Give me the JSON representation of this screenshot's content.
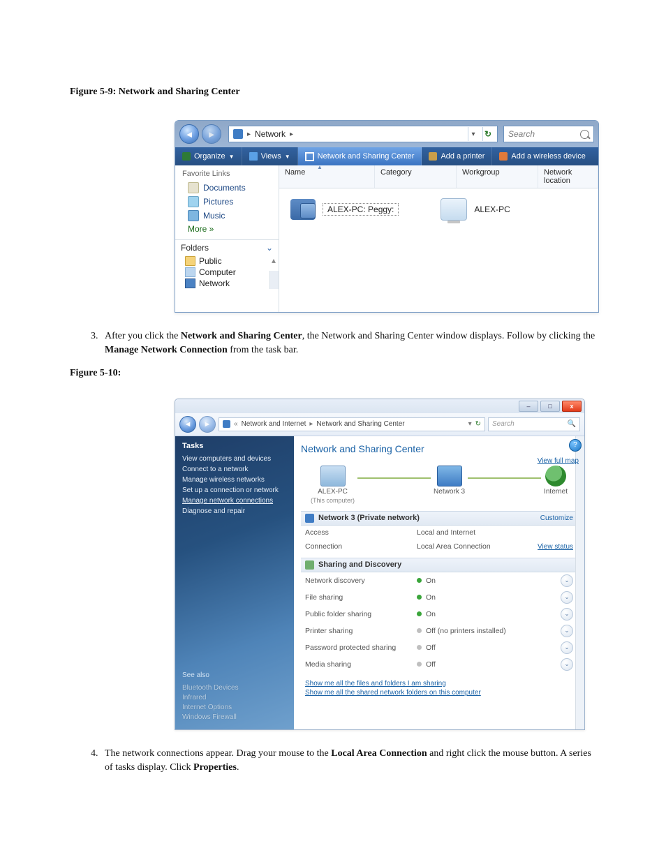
{
  "figures": {
    "f59_label": "Figure 5-9:",
    "f59_title": " Network and Sharing Center",
    "f510_label": "Figure 5-10:"
  },
  "step3": {
    "num": "3.",
    "before": "After you click the ",
    "b1": "Network and Sharing Center",
    "mid": ", the Network and Sharing Center window displays. Follow by clicking the ",
    "b2": "Manage Network Connection",
    "after": " from the task bar."
  },
  "step4": {
    "num": "4.",
    "before": "The network connections appear. Drag your mouse to the ",
    "b1": "Local Area Connection",
    "mid": " and right click the mouse button. A series of tasks display. Click ",
    "b2": "Properties",
    "after": "."
  },
  "explorer": {
    "address": {
      "root": "Network",
      "arrow": "▸"
    },
    "search_placeholder": "Search",
    "toolbar": {
      "organize": "Organize",
      "views": "Views",
      "nsc": "Network and Sharing Center",
      "add_printer": "Add a printer",
      "add_wireless": "Add a wireless device"
    },
    "nav": {
      "fav_header": "Favorite Links",
      "documents": "Documents",
      "pictures": "Pictures",
      "music": "Music",
      "more": "More  »",
      "folders_hdr": "Folders",
      "public": "Public",
      "computer": "Computer",
      "network": "Network"
    },
    "columns": {
      "name": "Name",
      "category": "Category",
      "workgroup": "Workgroup",
      "netloc": "Network location"
    },
    "items": {
      "computer_share": "ALEX-PC: Peggy:",
      "computer": "ALEX-PC"
    }
  },
  "nsc": {
    "breadcrumb": {
      "lvl1": "Network and Internet",
      "lvl2": "Network and Sharing Center",
      "back": "«"
    },
    "search_placeholder": "Search",
    "tasks_hdr": "Tasks",
    "tasks": {
      "t1": "View computers and devices",
      "t2": "Connect to a network",
      "t3": "Manage wireless networks",
      "t4": "Set up a connection or network",
      "t5": "Manage network connections",
      "t6": "Diagnose and repair"
    },
    "seealso_hdr": "See also",
    "seealso": {
      "s1": "Bluetooth Devices",
      "s2": "Infrared",
      "s3": "Internet Options",
      "s4": "Windows Firewall"
    },
    "main_title": "Network and Sharing Center",
    "view_full_map": "View full map",
    "map": {
      "pc": "ALEX-PC",
      "pc_sub": "(This computer)",
      "net": "Network 3",
      "inet": "Internet"
    },
    "panel1": {
      "title": "Network 3 (Private network)",
      "customize": "Customize"
    },
    "kv": {
      "access_k": "Access",
      "access_v": "Local and Internet",
      "conn_k": "Connection",
      "conn_v": "Local Area Connection",
      "view_status": "View status"
    },
    "panel2_title": "Sharing and Discovery",
    "sd": {
      "r1k": "Network discovery",
      "r1v": "On",
      "r2k": "File sharing",
      "r2v": "On",
      "r3k": "Public folder sharing",
      "r3v": "On",
      "r4k": "Printer sharing",
      "r4v": "Off (no printers installed)",
      "r5k": "Password protected sharing",
      "r5v": "Off",
      "r6k": "Media sharing",
      "r6v": "Off"
    },
    "footer": {
      "l1": "Show me all the files and folders I am sharing",
      "l2": "Show me all the shared network folders on this computer"
    }
  }
}
